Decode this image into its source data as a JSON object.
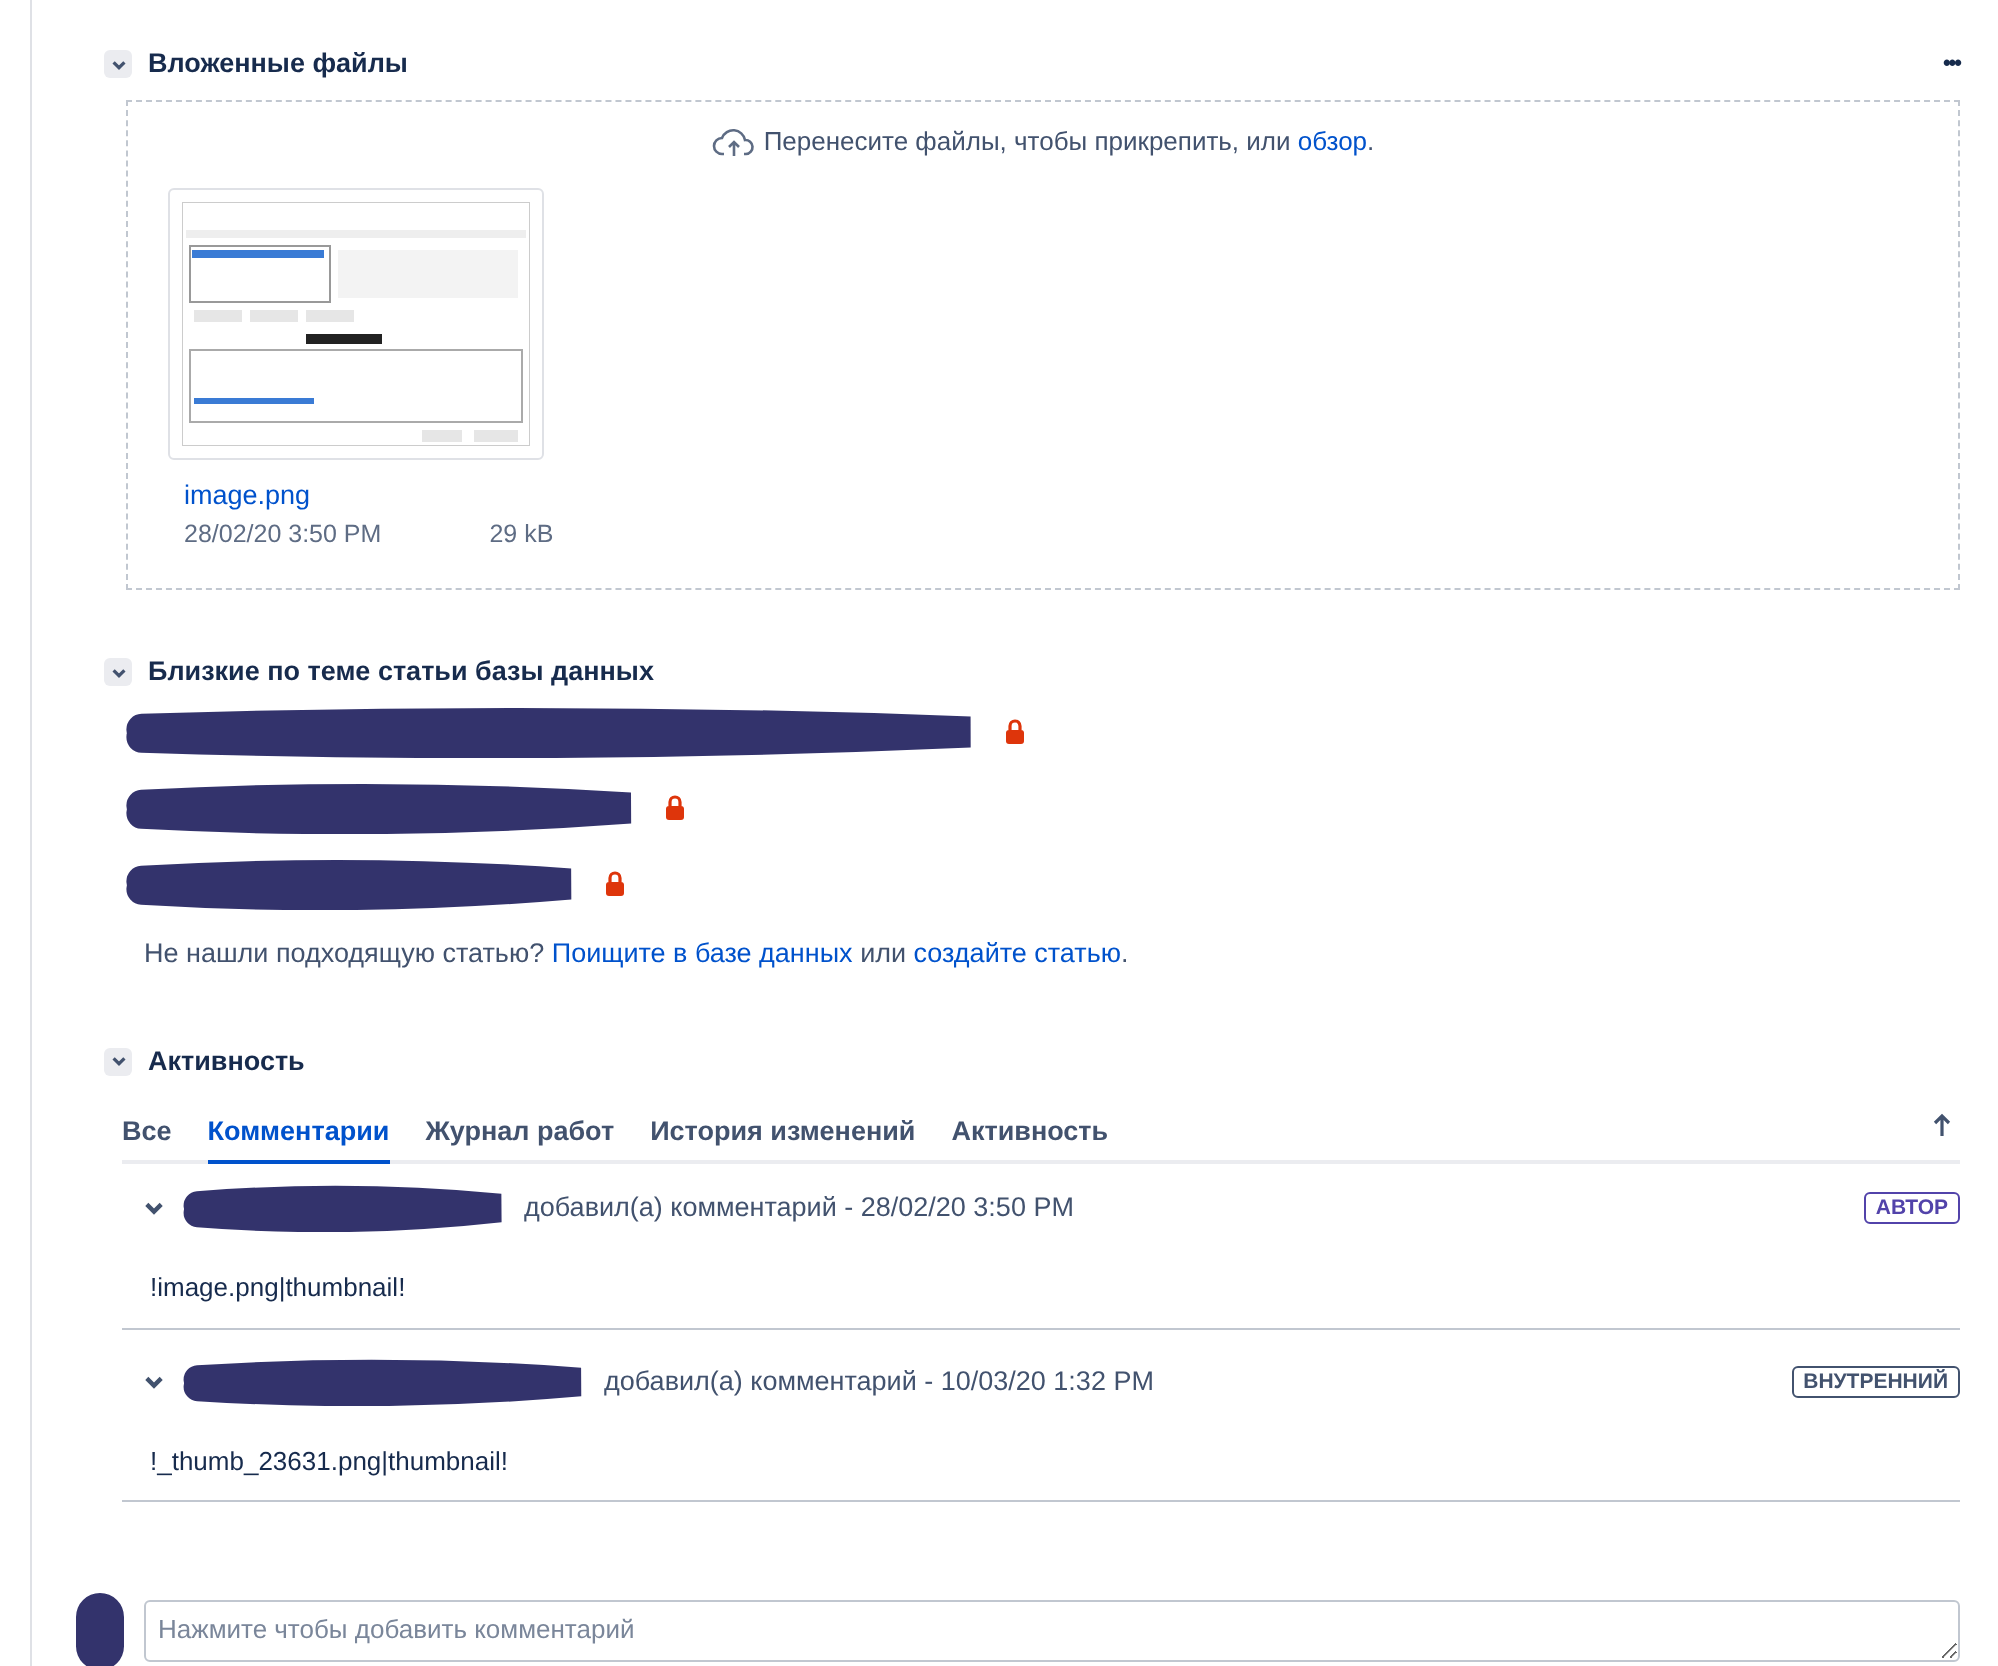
{
  "attachments": {
    "title": "Вложенные файлы",
    "expanded": true,
    "more_icon": "•••",
    "dropzone": {
      "text": "Перенесите файлы, чтобы прикрепить, или ",
      "link": "обзор",
      "after": "."
    },
    "files": [
      {
        "name": "image.png",
        "date": "28/02/20 3:50 PM",
        "size": "29 kB",
        "kind": "picture"
      }
    ]
  },
  "related": {
    "title": "Близкие по теме статьи базы данных",
    "expanded": true,
    "articles": [
      {
        "locked": true,
        "redacted": true
      },
      {
        "locked": true,
        "redacted": true
      },
      {
        "locked": true,
        "redacted": true
      }
    ],
    "footer": {
      "text": "Не нашли подходящую статью? ",
      "link1": "Поищите в базе данных",
      "middle": " или ",
      "link2": "создайте статью",
      "end": "."
    }
  },
  "activity": {
    "title": "Активность",
    "expanded": true,
    "tabs": [
      {
        "label": "Все",
        "selected": false
      },
      {
        "label": "Комментарии",
        "selected": true
      },
      {
        "label": "Журнал работ",
        "selected": false
      },
      {
        "label": "История изменений",
        "selected": false
      },
      {
        "label": "Активность",
        "selected": false
      }
    ],
    "comments": [
      {
        "expanded": true,
        "author_redacted": true,
        "meta": "добавил(а) комментарий - 28/02/20 3:50 PM",
        "badge": {
          "label": "АВТОР",
          "color": "#5243aa"
        },
        "body": "!image.png|thumbnail!"
      },
      {
        "expanded": true,
        "author_redacted": true,
        "meta": "добавил(а) комментарий - 10/03/20 1:32 PM",
        "badge": {
          "label": "ВНУТРЕННИЙ",
          "color": "#42526e"
        },
        "body": "!_thumb_23631.png|thumbnail!"
      }
    ],
    "new_comment": {
      "placeholder": "Нажмите чтобы добавить комментарий",
      "avatar_redacted": true
    }
  }
}
